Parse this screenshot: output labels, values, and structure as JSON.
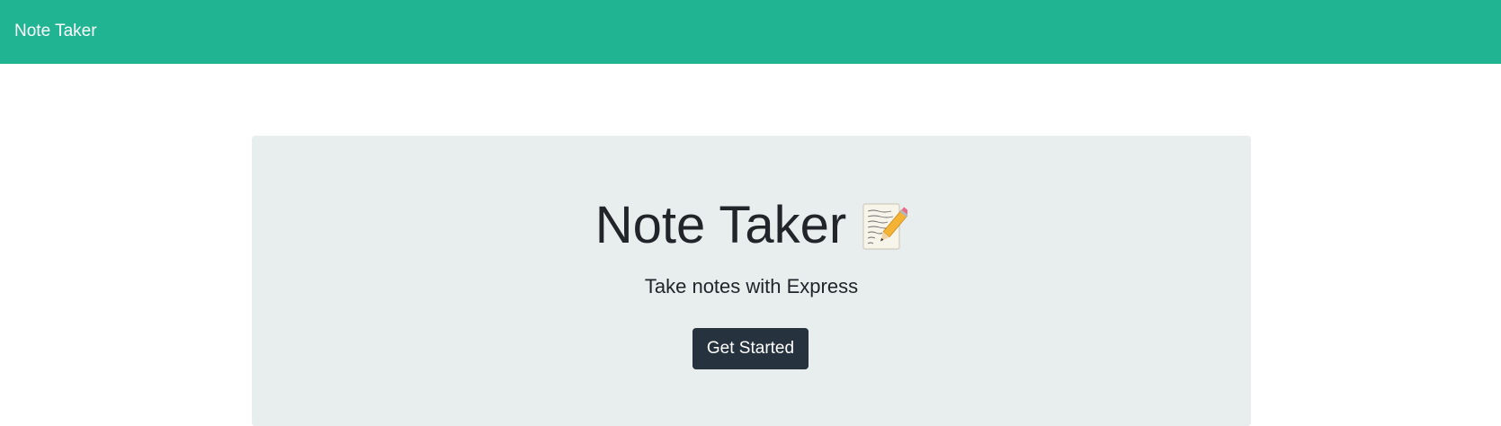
{
  "navbar": {
    "brand": "Note Taker",
    "background_color": "#20b493"
  },
  "hero": {
    "title": "Note Taker",
    "title_icon": "memo-icon",
    "subtitle": "Take notes with Express",
    "button_label": "Get Started",
    "button_color": "#27323f",
    "panel_color": "#e8edee"
  }
}
